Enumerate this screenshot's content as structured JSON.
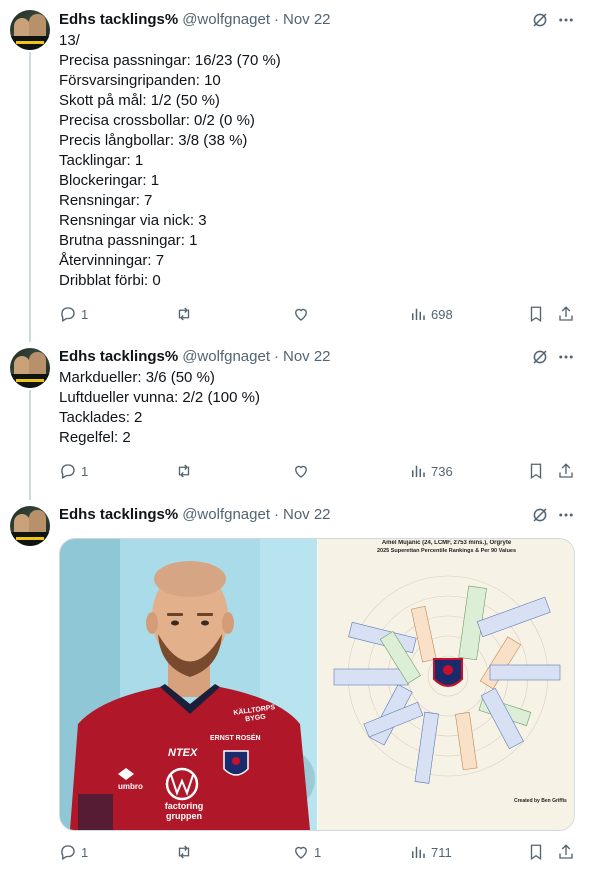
{
  "tweets": [
    {
      "author": {
        "name": "Edhs tacklings%",
        "handle": "@wolfgnaget",
        "date": "Nov 22"
      },
      "lines": [
        "13/",
        "Precisa passningar: 16/23 (70 %)",
        "Försvarsingripanden: 10",
        "Skott på mål: 1/2 (50 %)",
        "Precisa crossbollar: 0/2 (0 %)",
        "Precis långbollar: 3/8 (38 %)",
        "Tacklingar: 1",
        "Blockeringar: 1",
        "Rensningar: 7",
        "Rensningar via nick: 3",
        "Brutna passningar: 1",
        "Återvinningar: 7",
        "Dribblat förbi: 0"
      ],
      "stats": {
        "replies": "1",
        "retweets": "",
        "likes": "",
        "views": "698"
      }
    },
    {
      "author": {
        "name": "Edhs tacklings%",
        "handle": "@wolfgnaget",
        "date": "Nov 22"
      },
      "lines": [
        "Markdueller: 3/6 (50 %)",
        "Luftdueller vunna: 2/2 (100 %)",
        "Tacklades: 2",
        "Regelfel: 2"
      ],
      "stats": {
        "replies": "1",
        "retweets": "",
        "likes": "",
        "views": "736"
      }
    },
    {
      "author": {
        "name": "Edhs tacklings%",
        "handle": "@wolfgnaget",
        "date": "Nov 22"
      },
      "lines": [],
      "media": {
        "jersey_sponsor_top": "KÄLLTORPS BYGG",
        "jersey_sponsor_mid": "ERNST ROSÉN",
        "jersey_sponsor_left": "NTEX",
        "jersey_brand": "umbro",
        "jersey_sponsor_bottom": "factoring gruppen",
        "infographic_title_1": "Amel Mujanic (24, LCMF, 2753 mins.), Örgryte",
        "infographic_title_2": "2025 Superettan Percentile Rankings & Per 90 Values",
        "infographic_footer": "Created by Ben Griffis"
      },
      "stats": {
        "replies": "1",
        "retweets": "",
        "likes": "1",
        "views": "711"
      }
    }
  ],
  "colors": {
    "text": "#0f1419",
    "secondary": "#536471",
    "thread": "#cfd9de"
  },
  "icons": [
    "reply-icon",
    "retweet-icon",
    "like-icon",
    "views-icon",
    "bookmark-icon",
    "share-icon",
    "grok-icon",
    "more-icon"
  ]
}
